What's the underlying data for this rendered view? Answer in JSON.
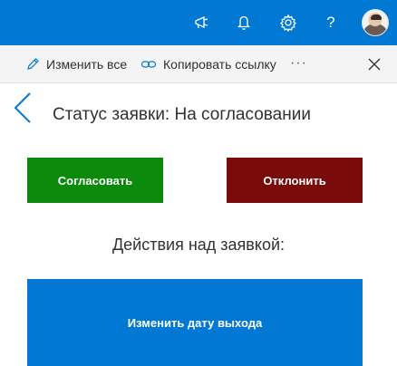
{
  "header": {
    "bg_color": "#0078d4",
    "icons": [
      "megaphone-icon",
      "bell-icon",
      "gear-icon",
      "help-icon"
    ],
    "help_label": "?"
  },
  "commandbar": {
    "edit_all_label": "Изменить все",
    "copy_link_label": "Копировать ссылку",
    "more_label": "···"
  },
  "main": {
    "status_text": "Статус заявки: На согласовании",
    "approve_label": "Согласовать",
    "reject_label": "Отклонить",
    "actions_title": "Действия над заявкой:",
    "change_date_label": "Изменить дату выхода"
  },
  "colors": {
    "approve": "#0b8a0b",
    "reject": "#7a0b0b",
    "primary": "#0078d4"
  }
}
